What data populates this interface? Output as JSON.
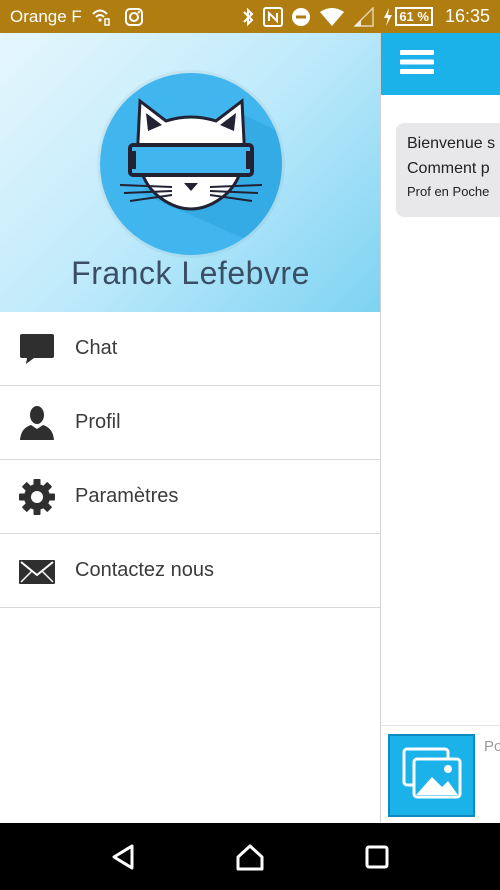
{
  "status_bar": {
    "carrier": "Orange F",
    "battery": "61 %",
    "time": "16:35",
    "icons": [
      "wifi-calling-icon",
      "instagram-icon",
      "bluetooth-icon",
      "nfc-icon",
      "do-not-disturb-icon",
      "wifi-icon",
      "signal-icon",
      "charging-icon",
      "battery-icon"
    ]
  },
  "drawer": {
    "user_name": "Franck Lefebvre",
    "avatar_icon": "cat-mascot-icon",
    "items": [
      {
        "label": "Chat",
        "icon": "chat-icon"
      },
      {
        "label": "Profil",
        "icon": "person-icon"
      },
      {
        "label": "Paramètres",
        "icon": "gear-icon"
      },
      {
        "label": "Contactez nous",
        "icon": "envelope-icon"
      }
    ]
  },
  "main": {
    "toolbar_icon": "menu-icon",
    "message": {
      "line1": "Bienvenue s",
      "line2": "Comment p",
      "sender": "Prof en Poche"
    },
    "composer": {
      "gallery_icon": "gallery-icon",
      "placeholder": "Po"
    }
  },
  "nav_bar": {
    "icons": [
      "back-icon",
      "home-icon",
      "recents-icon"
    ]
  },
  "colors": {
    "status_bar": "#b07d10",
    "accent": "#1ab2e8",
    "avatar_bg": "#41b6ee"
  }
}
